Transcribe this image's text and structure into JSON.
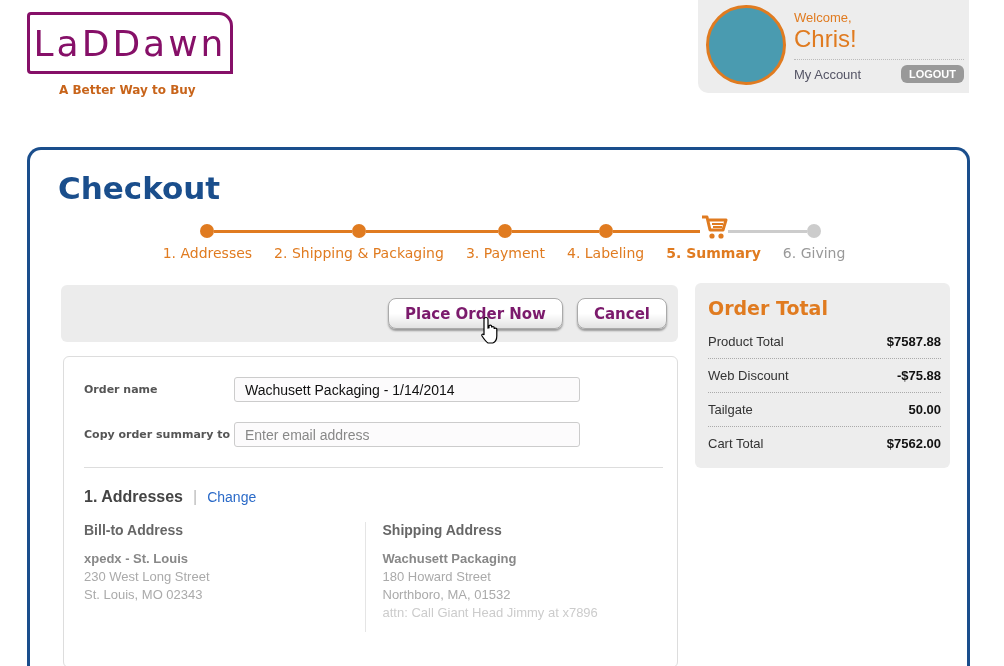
{
  "logo": {
    "text": "LaDDawn",
    "tagline": "A Better Way to Buy"
  },
  "user": {
    "welcome": "Welcome,",
    "name": "Chris!",
    "account_link": "My Account",
    "logout": "LOGOUT"
  },
  "title": "Checkout",
  "steps": [
    {
      "label": "1. Addresses",
      "done": true,
      "selected": false
    },
    {
      "label": "2. Shipping & Packaging",
      "done": true,
      "selected": false
    },
    {
      "label": "3. Payment",
      "done": true,
      "selected": false
    },
    {
      "label": "4. Labeling",
      "done": true,
      "selected": false
    },
    {
      "label": "5. Summary",
      "done": false,
      "selected": true
    },
    {
      "label": "6. Giving",
      "done": false,
      "selected": false
    }
  ],
  "actions": {
    "place_order": "Place Order Now",
    "cancel": "Cancel"
  },
  "form": [
    {
      "label": "Order name",
      "value": "Wachusett Packaging - 1/14/2014"
    },
    {
      "label": "Copy order summary to",
      "placeholder": "Enter email address"
    }
  ],
  "addresses": {
    "heading": "1. Addresses",
    "separator": "|",
    "change_link": "Change",
    "columns": [
      {
        "title": "Bill-to Address",
        "lines": [
          {
            "kind": "name",
            "text": "xpedx - St. Louis"
          },
          {
            "kind": "street",
            "text": "230 West Long Street"
          },
          {
            "kind": "city",
            "text": "St. Louis, MO 02343"
          }
        ]
      },
      {
        "title": "Shipping Address",
        "lines": [
          {
            "kind": "name",
            "text": "Wachusett Packaging"
          },
          {
            "kind": "street",
            "text": "180 Howard Street"
          },
          {
            "kind": "city",
            "text": "Northboro, MA, 01532"
          },
          {
            "kind": "note",
            "text": "attn: Call Giant Head Jimmy at x7896"
          }
        ]
      }
    ]
  },
  "order_total": {
    "title": "Order Total",
    "rows": [
      {
        "label": "Product Total",
        "value": "$7587.88"
      },
      {
        "label": "Web Discount",
        "value": "-$75.88"
      },
      {
        "label": "Tailgate",
        "value": "50.00"
      },
      {
        "label": "Cart Total",
        "value": "$7562.00"
      }
    ]
  }
}
